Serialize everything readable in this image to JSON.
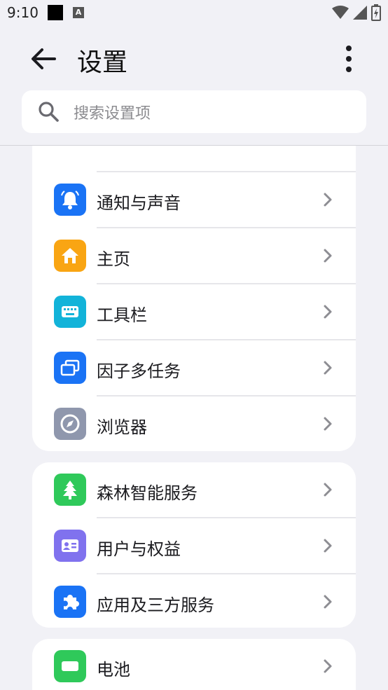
{
  "status_bar": {
    "time": "9:10",
    "notification_icon": "A"
  },
  "header": {
    "title": "设置"
  },
  "search": {
    "placeholder": "搜索设置项"
  },
  "groups": [
    {
      "items": [
        {
          "label": "通知与声音",
          "icon": "bell-icon",
          "color": "#1a73f5"
        },
        {
          "label": "主页",
          "icon": "home-icon",
          "color": "#f9a513"
        },
        {
          "label": "工具栏",
          "icon": "keyboard-icon",
          "color": "#12b3d9"
        },
        {
          "label": "因子多任务",
          "icon": "multitask-icon",
          "color": "#1a73f5"
        },
        {
          "label": "浏览器",
          "icon": "compass-icon",
          "color": "#8f97ad"
        }
      ]
    },
    {
      "items": [
        {
          "label": "森林智能服务",
          "icon": "tree-icon",
          "color": "#2fc95a"
        },
        {
          "label": "用户与权益",
          "icon": "id-card-icon",
          "color": "#8072ee"
        },
        {
          "label": "应用及三方服务",
          "icon": "puzzle-icon",
          "color": "#1a73f5"
        }
      ]
    },
    {
      "items": [
        {
          "label": "电池",
          "icon": "battery-icon",
          "color": "#2fc95a"
        }
      ]
    }
  ],
  "colors": {
    "background": "#f1f1f6",
    "card": "#ffffff",
    "partial_item_icon": "#f7794a"
  }
}
